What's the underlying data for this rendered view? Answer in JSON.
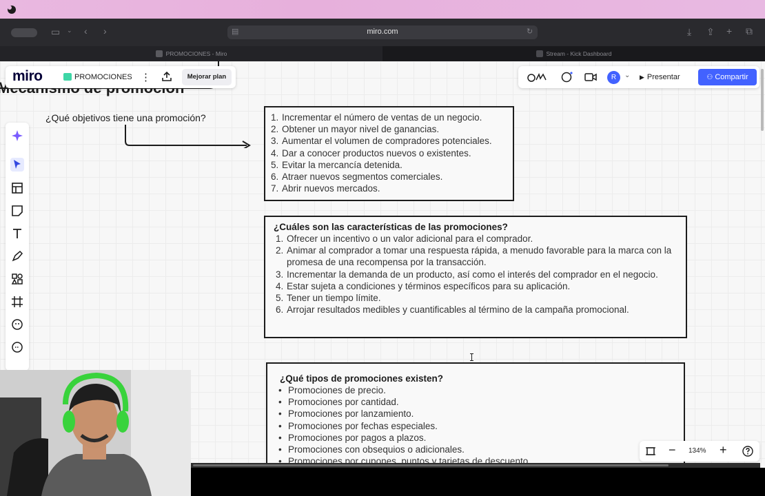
{
  "browser": {
    "url": "miro.com",
    "tabs": [
      {
        "label": "PROMOCIONES - Miro",
        "active": true
      },
      {
        "label": "Stream - Kick Dashboard",
        "active": false
      }
    ]
  },
  "miro": {
    "logo": "miro",
    "board_name": "PROMOCIONES",
    "upgrade_label": "Mejorar plan",
    "avatar_initial": "R",
    "present_label": "Presentar",
    "share_label": "Compartir",
    "zoom": "134%",
    "accent_color": "#4262ff"
  },
  "board": {
    "frame_title": "Mecanismo de promoción",
    "question1": "¿Qué objetivos tiene una promoción?",
    "objectives": [
      {
        "num": "1.",
        "text": "Incrementar el número de ventas de un negocio."
      },
      {
        "num": "2.",
        "text": "Obtener un mayor nivel de ganancias."
      },
      {
        "num": "3.",
        "text": "Aumentar el volumen de compradores potenciales."
      },
      {
        "num": "4.",
        "text": "Dar a conocer productos nuevos o existentes."
      },
      {
        "num": "5.",
        "text": "Evitar la mercancía detenida."
      },
      {
        "num": "6.",
        "text": "Atraer nuevos segmentos comerciales."
      },
      {
        "num": "7.",
        "text": "Abrir nuevos mercados."
      }
    ],
    "characteristics_title": "¿Cuáles son las características de las promociones?",
    "characteristics": [
      {
        "num": "1.",
        "text": "Ofrecer un incentivo o un valor adicional para el comprador."
      },
      {
        "num": "2.",
        "text": "Animar al comprador a tomar una respuesta rápida, a menudo favorable para la marca con la promesa de una recompensa por la transacción."
      },
      {
        "num": "3.",
        "text": "Incrementar la demanda de un producto, así como el interés del comprador en el negocio."
      },
      {
        "num": "4.",
        "text": "Estar sujeta a condiciones y términos específicos para su aplicación."
      },
      {
        "num": "5.",
        "text": "Tener un tiempo límite."
      },
      {
        "num": "6.",
        "text": "Arrojar resultados medibles y cuantificables al término de la campaña promocional."
      }
    ],
    "types_title": "¿Qué tipos de promociones existen?",
    "types": [
      {
        "bullet": "•",
        "text": "Promociones de precio."
      },
      {
        "bullet": "•",
        "text": "Promociones por cantidad."
      },
      {
        "bullet": "•",
        "text": "Promociones por lanzamiento."
      },
      {
        "bullet": "•",
        "text": "Promociones por fechas especiales."
      },
      {
        "bullet": "•",
        "text": "Promociones por pagos a plazos."
      },
      {
        "bullet": "•",
        "text": "Promociones con obsequios o adicionales."
      },
      {
        "bullet": "•",
        "text": "Promociones por cupones, puntos y tarjetas de descuento."
      }
    ]
  }
}
